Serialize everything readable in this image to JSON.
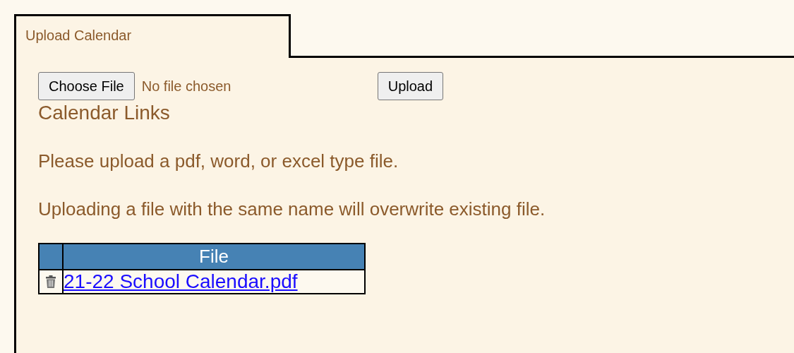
{
  "tab": {
    "label": "Upload Calendar"
  },
  "file_picker": {
    "button": "Choose File",
    "status": "No file chosen"
  },
  "upload_button": "Upload",
  "heading": "Calendar Links",
  "notes": [
    "Please upload a pdf, word, or excel type file.",
    "Uploading a file with the same name will overwrite existing file."
  ],
  "table": {
    "columns": [
      "File"
    ],
    "rows": [
      {
        "file": "21-22 School Calendar.pdf"
      }
    ]
  }
}
